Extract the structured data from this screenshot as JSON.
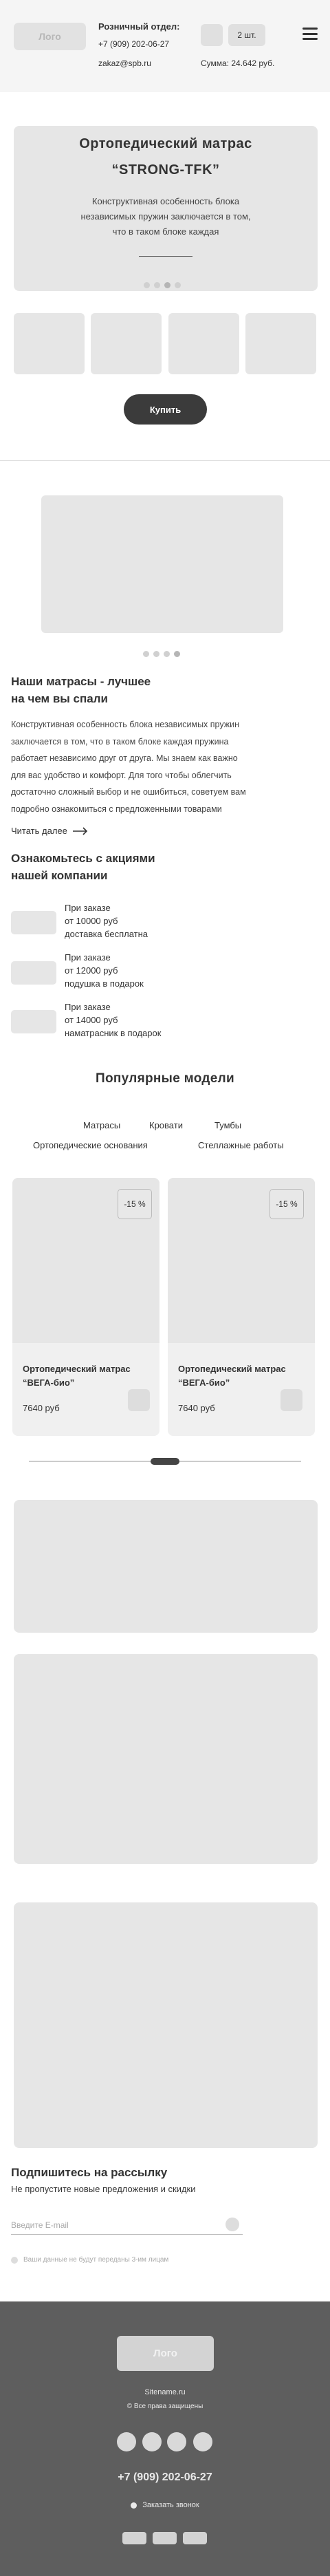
{
  "header": {
    "logo": "Лого",
    "retail_label": "Розничный отдел:",
    "phone": "+7 (909) 202-06-27",
    "email": "zakaz@spb.ru",
    "qty": "2 шт.",
    "sum": "Сумма: 24.642 руб."
  },
  "hero": {
    "title_line1": "Ортопедический матрас",
    "title_line2": "“STRONG-TFK”",
    "desc_line1": "Конструктивная особенность блока",
    "desc_line2": "независимых пружин заключается в том,",
    "desc_line3": "что в таком блоке каждая",
    "slides_total": 4,
    "active_slide": 3
  },
  "buy_button": "Купить",
  "gallery": {
    "slides_total": 4,
    "active_slide": 4
  },
  "about": {
    "title_line1": "Наши матрасы - лучшее",
    "title_line2": "на чем вы спали",
    "para_lines": [
      "Конструктивная особенность блока независимых пружин",
      "заключается в том, что в таком блоке каждая пружина",
      "работает независимо друг от друга. Мы знаем как важно",
      "для вас удобство и комфорт. Для того чтобы облегчить",
      "достаточно сложный выбор и не ошибиться, советуем вам",
      "подробно ознакомиться с предложенными товарами"
    ],
    "read_more": "Читать далее"
  },
  "promos": {
    "title_line1": "Ознакомьтесь с акциями",
    "title_line2": "нашей компании",
    "items": [
      {
        "line1": "При заказе",
        "line2": "от 10000 руб",
        "line3": "доставка бесплатна"
      },
      {
        "line1": "При заказе",
        "line2": "от 12000 руб",
        "line3": "подушка в подарок"
      },
      {
        "line1": "При заказе",
        "line2": "от 14000 руб",
        "line3": "наматрасник в подарок"
      }
    ]
  },
  "popular": {
    "title": "Популярные модели",
    "categories_row1": [
      "Матрасы",
      "Кровати",
      "Тумбы"
    ],
    "categories_row2": [
      "Ортопедические основания",
      "Стеллажные работы"
    ],
    "products": [
      {
        "badge": "-15 %",
        "title_line1": "Ортопедический матрас",
        "title_line2": "“ВЕГА-био”",
        "price": "7640 руб"
      },
      {
        "badge": "-15 %",
        "title_line1": "Ортопедический матрас",
        "title_line2": "“ВЕГА-био”",
        "price": "7640 руб"
      }
    ]
  },
  "newsletter": {
    "title": "Подпишитесь на рассылку",
    "subtitle": "Не пропустите новые предложения и скидки",
    "placeholder": "Введите E-mail",
    "consent": "Ваши данные не будут переданы 3-им лицам"
  },
  "footer": {
    "logo": "Лого",
    "site": "Sitename.ru",
    "rights": "© Все права защищены",
    "phone": "+7 (909) 202-06-27",
    "callback": "Заказать звонок"
  },
  "colors": {
    "placeholder_gray": "#e6e6e6",
    "header_bg": "#f5f5f5",
    "button_dark": "#3b3b3b",
    "footer_bg": "#5e5e5e"
  }
}
